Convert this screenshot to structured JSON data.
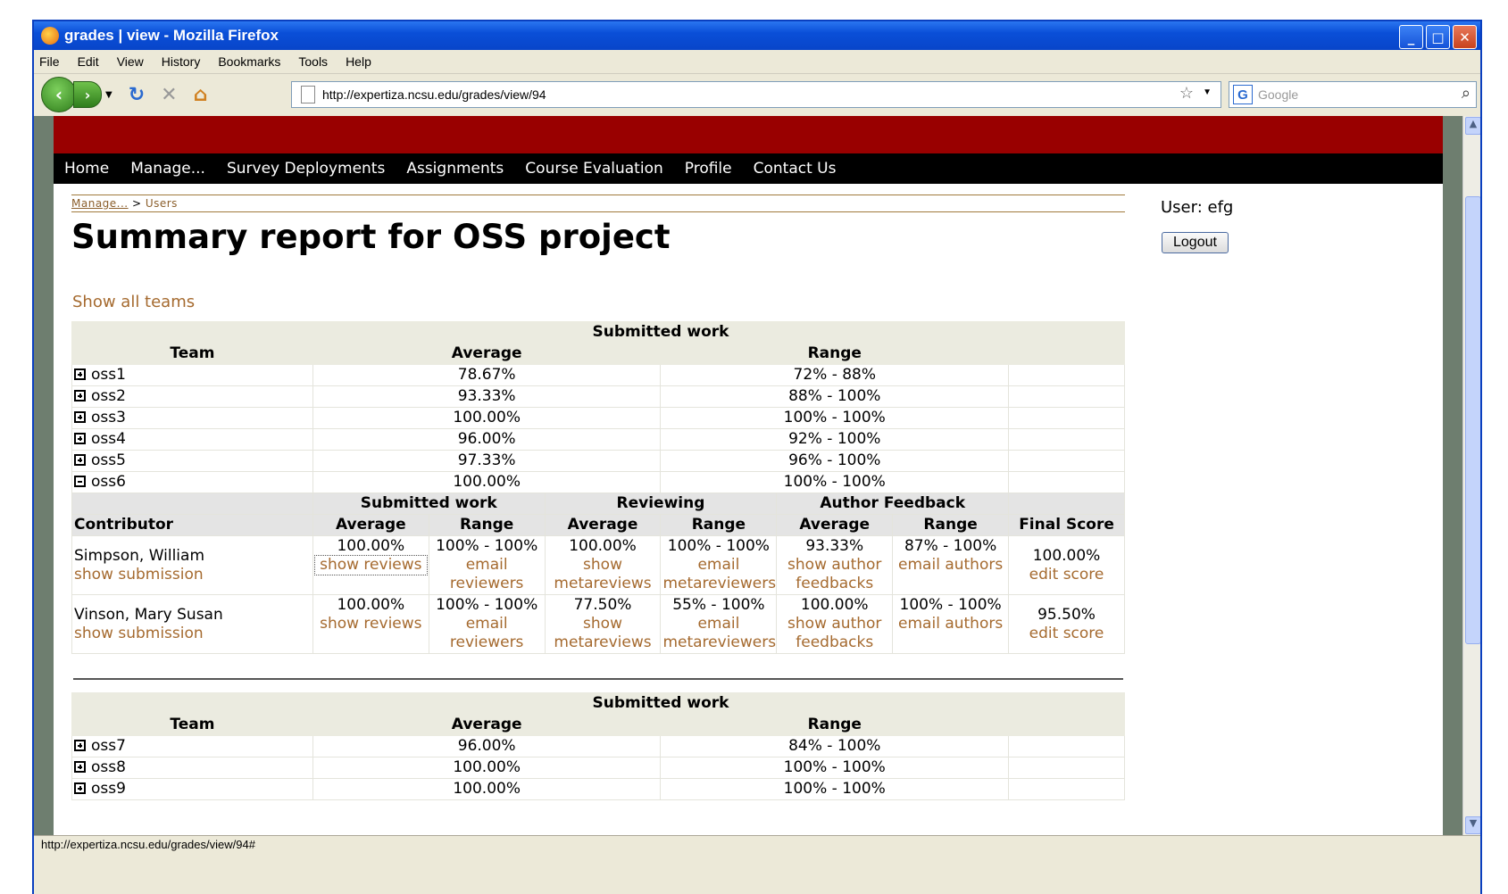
{
  "window": {
    "title": "grades | view - Mozilla Firefox"
  },
  "menu": [
    "File",
    "Edit",
    "View",
    "History",
    "Bookmarks",
    "Tools",
    "Help"
  ],
  "url": "http://expertiza.ncsu.edu/grades/view/94",
  "search_placeholder": "Google",
  "nav": [
    "Home",
    "Manage...",
    "Survey Deployments",
    "Assignments",
    "Course Evaluation",
    "Profile",
    "Contact Us"
  ],
  "breadcrumb": {
    "manage": "Manage...",
    "sep": ">",
    "users": "Users"
  },
  "page_title": "Summary report for OSS project",
  "show_all": "Show all teams",
  "user_label": "User: efg",
  "logout": "Logout",
  "table1": {
    "group_header": "Submitted work",
    "cols": [
      "Team",
      "Average",
      "Range"
    ],
    "teams": [
      {
        "name": "oss1",
        "avg": "78.67%",
        "range": "72% - 88%"
      },
      {
        "name": "oss2",
        "avg": "93.33%",
        "range": "88% - 100%"
      },
      {
        "name": "oss3",
        "avg": "100.00%",
        "range": "100% - 100%"
      },
      {
        "name": "oss4",
        "avg": "96.00%",
        "range": "92% - 100%"
      },
      {
        "name": "oss5",
        "avg": "97.33%",
        "range": "96% - 100%"
      },
      {
        "name": "oss6",
        "avg": "100.00%",
        "range": "100% - 100%"
      }
    ]
  },
  "detail": {
    "groups": [
      "Submitted work",
      "Reviewing",
      "Author Feedback"
    ],
    "cols": [
      "Contributor",
      "Average",
      "Range",
      "Average",
      "Range",
      "Average",
      "Range",
      "Final Score"
    ],
    "rows": [
      {
        "name": "Simpson, William",
        "sub": "show submission",
        "sw_avg": "100.00%",
        "sw_link": "show reviews",
        "sw_range": "100% - 100%",
        "sw_rlink": "email reviewers",
        "rv_avg": "100.00%",
        "rv_link": "show metareviews",
        "rv_range": "100% - 100%",
        "rv_rlink": "email metareviewers",
        "af_avg": "93.33%",
        "af_link": "show author feedbacks",
        "af_range": "87% - 100%",
        "af_rlink": "email authors",
        "final": "100.00%",
        "edit": "edit score"
      },
      {
        "name": "Vinson, Mary Susan",
        "sub": "show submission",
        "sw_avg": "100.00%",
        "sw_link": "show reviews",
        "sw_range": "100% - 100%",
        "sw_rlink": "email reviewers",
        "rv_avg": "77.50%",
        "rv_link": "show metareviews",
        "rv_range": "55% - 100%",
        "rv_rlink": "email metareviewers",
        "af_avg": "100.00%",
        "af_link": "show author feedbacks",
        "af_range": "100% - 100%",
        "af_rlink": "email authors",
        "final": "95.50%",
        "edit": "edit score"
      }
    ]
  },
  "table2": {
    "group_header": "Submitted work",
    "cols": [
      "Team",
      "Average",
      "Range"
    ],
    "teams": [
      {
        "name": "oss7",
        "avg": "96.00%",
        "range": "84% - 100%"
      },
      {
        "name": "oss8",
        "avg": "100.00%",
        "range": "100% - 100%"
      },
      {
        "name": "oss9",
        "avg": "100.00%",
        "range": "100% - 100%"
      }
    ]
  },
  "status": "http://expertiza.ncsu.edu/grades/view/94#"
}
